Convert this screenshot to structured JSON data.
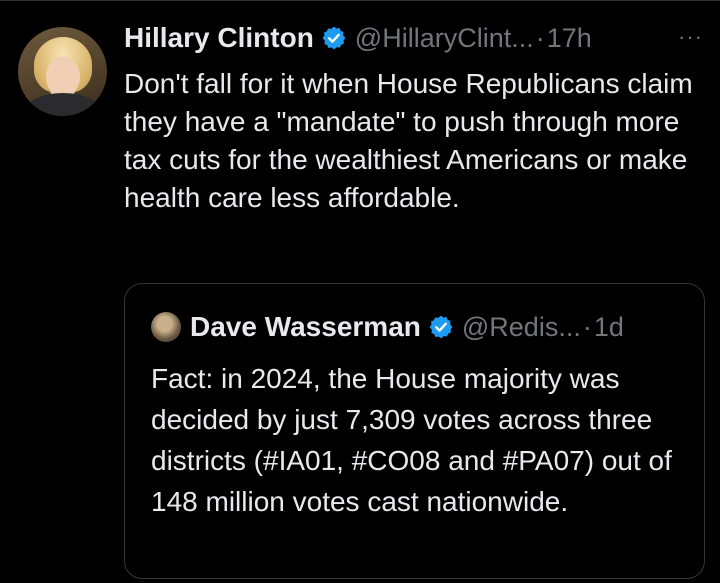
{
  "tweet": {
    "author_name": "Hillary Clinton",
    "handle": "@HillaryClint...",
    "separator": "·",
    "time": "17h",
    "more_label": "···",
    "text": "Don't fall for it when House Republicans claim they have a \"mandate\" to push through more tax cuts for the wealthiest Americans or make health care less affordable."
  },
  "quoted_tweet": {
    "author_name": "Dave Wasserman",
    "handle": "@Redis...",
    "separator": "·",
    "time": "1d",
    "text": "Fact: in 2024, the House majority was decided by just 7,309 votes across three districts (#IA01, #CO08 and #PA07) out of 148 million votes cast nationwide."
  },
  "icons": {
    "verified": "verified-badge-icon",
    "more": "more-options-icon"
  },
  "colors": {
    "background": "#000000",
    "text": "#e7e9ea",
    "secondary": "#71767b",
    "verified": "#1d9bf0",
    "border": "#333639"
  }
}
